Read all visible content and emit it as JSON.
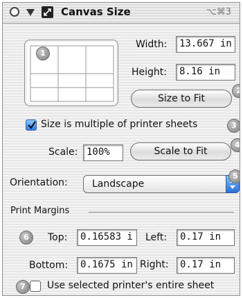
{
  "window": {
    "title": "Canvas Size",
    "shortcut": "⌥⌘3"
  },
  "badges": [
    "1",
    "2",
    "3",
    "4",
    "5",
    "6",
    "7"
  ],
  "size": {
    "width_label": "Width:",
    "width_value": "13.667 in",
    "height_label": "Height:",
    "height_value": "8.16 in",
    "size_to_fit_label": "Size to Fit"
  },
  "multiple": {
    "label": "Size is multiple of printer sheets",
    "checked": true
  },
  "scale": {
    "label": "Scale:",
    "value": "100%",
    "scale_to_fit_label": "Scale to Fit"
  },
  "orientation": {
    "label": "Orientation:",
    "selected": "Landscape"
  },
  "margins": {
    "section_label": "Print Margins",
    "top_label": "Top:",
    "top_value": "0.16583 i",
    "left_label": "Left:",
    "left_value": "0.17 in",
    "bottom_label": "Bottom:",
    "bottom_value": "0.1675 in",
    "right_label": "Right:",
    "right_value": "0.17 in"
  },
  "entire_sheet": {
    "label": "Use selected printer's entire sheet",
    "checked": false
  },
  "colors": {
    "accent": "#2d80e8",
    "badge": "#8f8f8f"
  }
}
